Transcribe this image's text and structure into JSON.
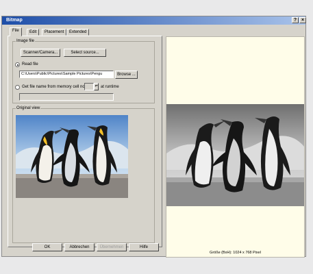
{
  "window": {
    "title": "Bitmap",
    "help_glyph": "?",
    "close_glyph": "×"
  },
  "tabs": [
    "File",
    "Edit",
    "Placement",
    "Extended"
  ],
  "image_file": {
    "group_label": "Image file",
    "scanner_button": "Scanner/Camera...",
    "select_source_button": "Select source...",
    "read_file_label": "Read file",
    "file_path": "C:\\Users\\Public\\Pictures\\Sample Pictures\\Pengu",
    "browse_button": "Browse ...",
    "memory_cell_label": "Get file name from memory cell no.",
    "memory_cell_value": "",
    "at_runtime_label": "at runtime",
    "memory_result_value": ""
  },
  "original_view": {
    "group_label": "Original view"
  },
  "preview": {
    "size_text": "Größe (BxH): 1024 x 768 Pixel"
  },
  "buttons": {
    "ok": "OK",
    "cancel": "Abbrechen",
    "apply": "Übernehmen",
    "help": "Hilfe"
  }
}
